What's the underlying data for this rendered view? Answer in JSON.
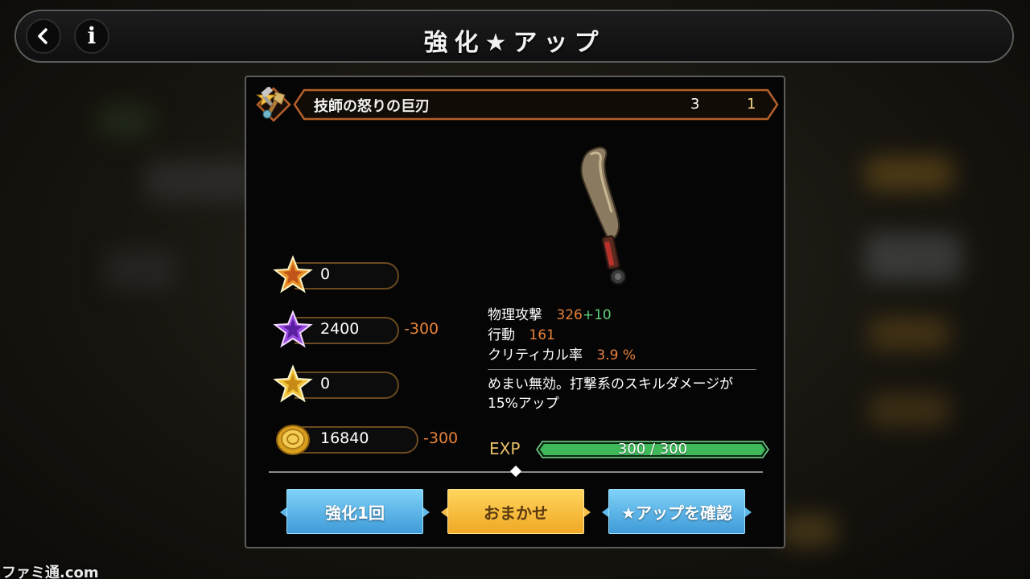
{
  "header": {
    "title": "強化★アップ",
    "back_icon": "back-arrow-icon",
    "info_icon": "info-icon"
  },
  "item": {
    "name": "技師の怒りの巨刃",
    "rarity": "3",
    "level": "1",
    "icon": "greataxe-icon"
  },
  "resources": [
    {
      "icon": "orange-star-icon",
      "value": "0",
      "delta": ""
    },
    {
      "icon": "purple-star-icon",
      "value": "2400",
      "delta": "-300"
    },
    {
      "icon": "gold-star-icon",
      "value": "0",
      "delta": ""
    },
    {
      "icon": "gold-coin-icon",
      "value": "16840",
      "delta": "-300"
    }
  ],
  "stats": {
    "attack_label": "物理攻撃",
    "attack_value": "326",
    "attack_bonus": "+10",
    "action_label": "行動",
    "action_value": "161",
    "crit_label": "クリティカル率",
    "crit_value": "3.9 %"
  },
  "description": "めまい無効。打撃系のスキルダメージが15%アップ",
  "exp": {
    "label": "EXP",
    "text": "300 / 300",
    "progress": 1.0
  },
  "buttons": {
    "enhance_once": "強化1回",
    "auto": "おまかせ",
    "confirm_star_up": "★アップを確認"
  },
  "watermark": "ファミ通.com",
  "colors": {
    "accent_orange": "#e8823a",
    "bonus_green": "#5fd07a",
    "exp_green": "#3fb85a",
    "button_blue": "#4aa6e0",
    "button_gold": "#f5b830"
  }
}
